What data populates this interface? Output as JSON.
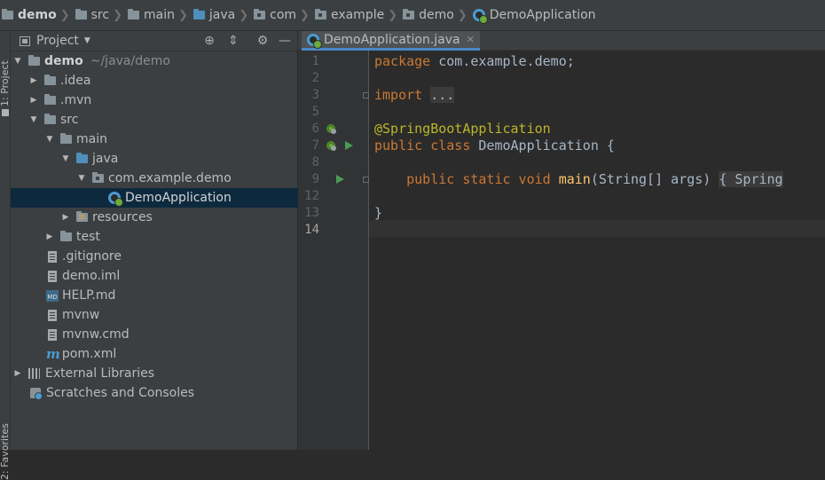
{
  "breadcrumb": [
    {
      "label": "demo",
      "icon": "module-folder-icon"
    },
    {
      "label": "src",
      "icon": "folder-icon"
    },
    {
      "label": "main",
      "icon": "folder-icon"
    },
    {
      "label": "java",
      "icon": "source-folder-icon"
    },
    {
      "label": "com",
      "icon": "package-icon"
    },
    {
      "label": "example",
      "icon": "package-icon"
    },
    {
      "label": "demo",
      "icon": "package-icon"
    },
    {
      "label": "DemoApplication",
      "icon": "spring-class-icon"
    }
  ],
  "side_tabs": {
    "project": "1: Project",
    "favorites": "2: Favorites"
  },
  "project_panel": {
    "title": "Project",
    "tree": [
      {
        "label": "demo",
        "path": "~/java/demo",
        "icon": "module-folder-icon",
        "depth": 0,
        "expanded": true
      },
      {
        "label": ".idea",
        "icon": "folder-icon",
        "depth": 1,
        "expanded": false
      },
      {
        "label": ".mvn",
        "icon": "folder-icon",
        "depth": 1,
        "expanded": false
      },
      {
        "label": "src",
        "icon": "folder-icon",
        "depth": 1,
        "expanded": true
      },
      {
        "label": "main",
        "icon": "folder-icon",
        "depth": 2,
        "expanded": true
      },
      {
        "label": "java",
        "icon": "source-folder-icon",
        "depth": 3,
        "expanded": true
      },
      {
        "label": "com.example.demo",
        "icon": "package-icon",
        "depth": 4,
        "expanded": true
      },
      {
        "label": "DemoApplication",
        "icon": "spring-class-icon",
        "depth": 5,
        "selected": true
      },
      {
        "label": "resources",
        "icon": "resources-folder-icon",
        "depth": 3,
        "expanded": false
      },
      {
        "label": "test",
        "icon": "folder-icon",
        "depth": 2,
        "expanded": false
      },
      {
        "label": ".gitignore",
        "icon": "file-icon",
        "depth": 1
      },
      {
        "label": "demo.iml",
        "icon": "file-icon",
        "depth": 1
      },
      {
        "label": "HELP.md",
        "icon": "markdown-icon",
        "depth": 1
      },
      {
        "label": "mvnw",
        "icon": "file-icon",
        "depth": 1
      },
      {
        "label": "mvnw.cmd",
        "icon": "file-icon",
        "depth": 1
      },
      {
        "label": "pom.xml",
        "icon": "maven-icon",
        "depth": 1
      },
      {
        "label": "External Libraries",
        "icon": "libraries-icon",
        "depth": 0,
        "expanded": false
      },
      {
        "label": "Scratches and Consoles",
        "icon": "scratches-icon",
        "depth": 0
      }
    ]
  },
  "editor": {
    "tab_label": "DemoApplication.java",
    "current_line": 14,
    "line_numbers": [
      "1",
      "2",
      "3",
      "5",
      "6",
      "7",
      "8",
      "9",
      "12",
      "13",
      "14"
    ],
    "code": {
      "l1_kw": "package",
      "l1_rest": " com.example.demo;",
      "l3_kw": "import",
      "l3_fold": "...",
      "l6_ann": "@SpringBootApplication",
      "l7_kw": "public class",
      "l7_rest": " DemoApplication {",
      "l9_kw": "public static void",
      "l9_fn": "main",
      "l9_rest": "(String[] args)",
      "l9_fold": "{ Spring",
      "l13": "}"
    }
  }
}
